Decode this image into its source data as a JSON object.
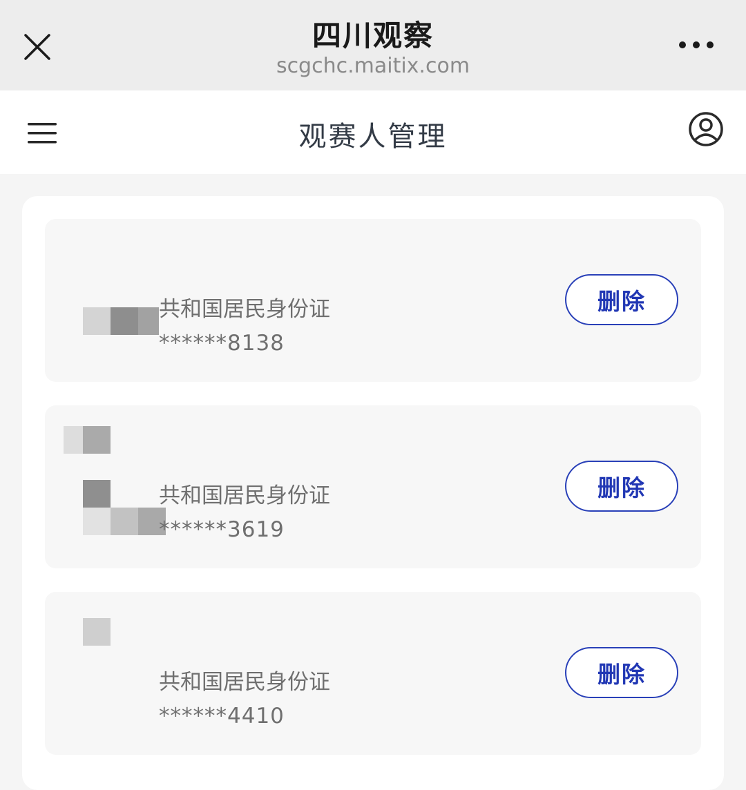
{
  "browser": {
    "title": "四川观察",
    "url": "scgchc.maitix.com",
    "close_icon": "close-icon",
    "more_icon": "more-horizontal-icon"
  },
  "header": {
    "title": "观赛人管理",
    "menu_icon": "hamburger-menu-icon",
    "user_icon": "user-account-icon"
  },
  "colors": {
    "accent": "#2137b4",
    "card_bg": "#f7f7f7",
    "page_bg": "#f5f5f5",
    "browser_bar": "#ededed"
  },
  "viewers": [
    {
      "id_type": "共和国居民身份证",
      "id_number": "******8138",
      "delete_label": "删除"
    },
    {
      "id_type": "共和国居民身份证",
      "id_number": "******3619",
      "delete_label": "删除"
    },
    {
      "id_type": "共和国居民身份证",
      "id_number": "******4410",
      "delete_label": "删除"
    }
  ]
}
